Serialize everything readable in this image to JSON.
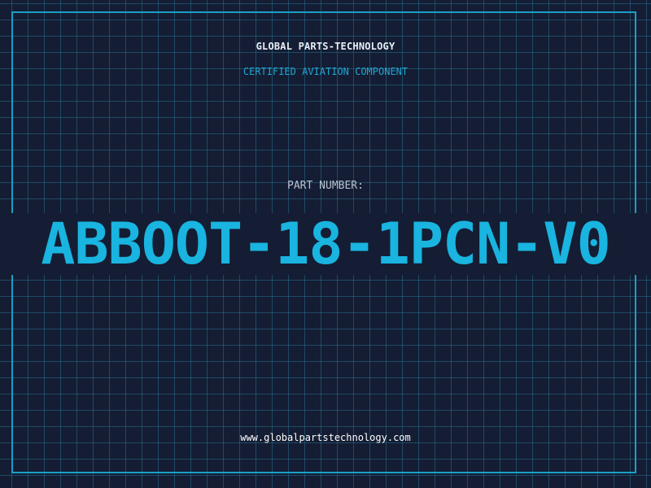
{
  "header": {
    "company_name": "GLOBAL PARTS-TECHNOLOGY",
    "subtitle": "CERTIFIED AVIATION COMPONENT"
  },
  "part": {
    "label": "PART NUMBER:",
    "number": "ABBOOT-18-1PCN-V0"
  },
  "footer": {
    "website": "www.globalpartstechnology.com"
  },
  "colors": {
    "background": "#141d33",
    "grid": "#286e8c",
    "frame": "#1b9fc7",
    "accent": "#19b4e0",
    "text": "#e8edf5"
  }
}
